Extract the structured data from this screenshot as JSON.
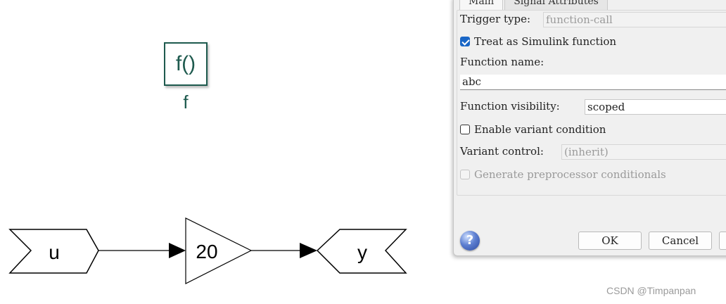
{
  "model": {
    "function_block": {
      "glyph": "f()",
      "label": "f"
    },
    "inport": {
      "label": "u"
    },
    "gain": {
      "value": "20"
    },
    "outport": {
      "label": "y"
    }
  },
  "dialog": {
    "tabs": [
      "Main",
      "Signal Attributes"
    ],
    "trigger_type": {
      "label": "Trigger type:",
      "value": "function-call"
    },
    "treat_as_simulink_function": {
      "label": "Treat as Simulink function",
      "checked": true
    },
    "function_name": {
      "label": "Function name:",
      "value": "abc"
    },
    "function_visibility": {
      "label": "Function visibility:",
      "value": "scoped"
    },
    "enable_variant_condition": {
      "label": "Enable variant condition",
      "checked": false
    },
    "variant_control": {
      "label": "Variant control:",
      "value": "(inherit)"
    },
    "generate_preprocessor_conditionals": {
      "label": "Generate preprocessor conditionals",
      "checked": false
    },
    "buttons": {
      "ok": "OK",
      "cancel": "Cancel"
    },
    "help_icon": "help-question-icon"
  },
  "watermark": "CSDN @Timpanpan"
}
